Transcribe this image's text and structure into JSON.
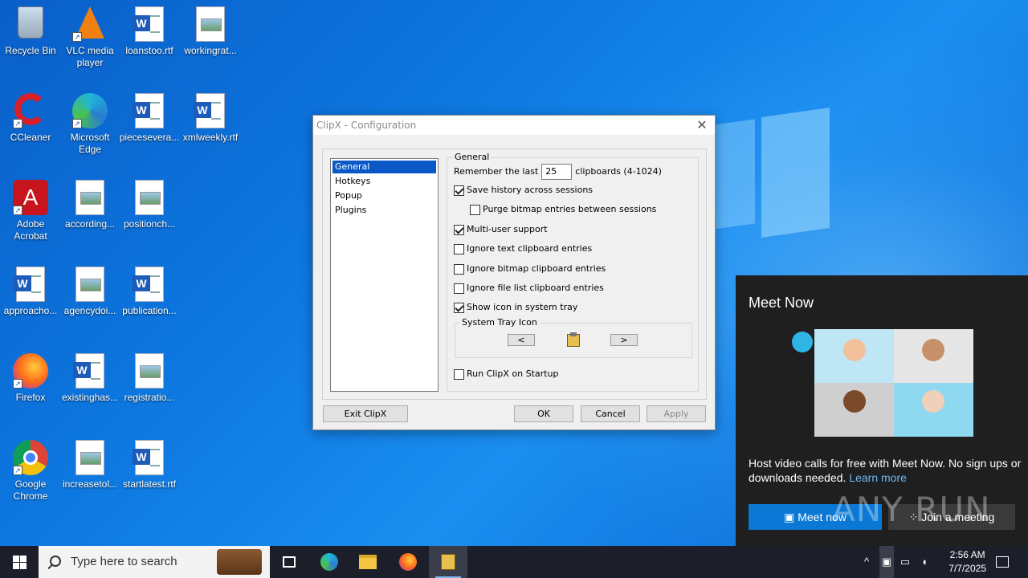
{
  "desktop": {
    "icons": [
      {
        "label": "Recycle Bin",
        "icon": "recycle-bin-icon"
      },
      {
        "label": "VLC media player",
        "icon": "vlc-icon"
      },
      {
        "label": "loanstoo.rtf",
        "icon": "word-doc-icon"
      },
      {
        "label": "workingrat...",
        "icon": "image-file-icon"
      },
      {
        "label": "CCleaner",
        "icon": "ccleaner-icon"
      },
      {
        "label": "Microsoft Edge",
        "icon": "edge-icon"
      },
      {
        "label": "piecesevera...",
        "icon": "word-doc-icon"
      },
      {
        "label": "xmlweekly.rtf",
        "icon": "word-doc-icon"
      },
      {
        "label": "Adobe Acrobat",
        "icon": "acrobat-icon"
      },
      {
        "label": "according...",
        "icon": "image-file-icon"
      },
      {
        "label": "positionch...",
        "icon": "image-file-icon"
      },
      {
        "label": "approacho...",
        "icon": "word-doc-icon"
      },
      {
        "label": "agencydoi...",
        "icon": "image-file-icon"
      },
      {
        "label": "publication...",
        "icon": "word-doc-icon"
      },
      {
        "label": "Firefox",
        "icon": "firefox-icon"
      },
      {
        "label": "existinghas...",
        "icon": "word-doc-icon"
      },
      {
        "label": "registratio...",
        "icon": "image-file-icon"
      },
      {
        "label": "Google Chrome",
        "icon": "chrome-icon"
      },
      {
        "label": "increasetol...",
        "icon": "image-file-icon"
      },
      {
        "label": "startlatest.rtf",
        "icon": "word-doc-icon"
      }
    ]
  },
  "dialog": {
    "title": "ClipX - Configuration",
    "tree": [
      "General",
      "Hotkeys",
      "Popup",
      "Plugins"
    ],
    "group_title": "General",
    "remember_prefix": "Remember the last",
    "remember_value": "25",
    "remember_suffix": "clipboards (4-1024)",
    "options": [
      {
        "label": "Save history across sessions",
        "checked": true
      },
      {
        "label": "Purge bitmap entries between sessions",
        "checked": false
      },
      {
        "label": "Multi-user support",
        "checked": true
      },
      {
        "label": "Ignore text clipboard entries",
        "checked": false
      },
      {
        "label": "Ignore bitmap clipboard entries",
        "checked": false
      },
      {
        "label": "Ignore file list clipboard entries",
        "checked": false
      },
      {
        "label": "Show icon in system tray",
        "checked": true
      },
      {
        "label": "Run ClipX on Startup",
        "checked": false
      }
    ],
    "tray_group_title": "System Tray Icon",
    "prev_label": "<",
    "next_label": ">",
    "buttons": {
      "exit": "Exit ClipX",
      "ok": "OK",
      "cancel": "Cancel",
      "apply": "Apply"
    }
  },
  "meet_now": {
    "title": "Meet Now",
    "description": "Host video calls for free with Meet Now. No sign ups or downloads needed.",
    "learn_more": "Learn more",
    "meet_now_button": "Meet now",
    "join_button": "Join a meeting"
  },
  "watermark": "ANY RUN",
  "taskbar": {
    "search_placeholder": "Type here to search",
    "time": "2:56 AM",
    "date": "7/7/2025"
  },
  "colors": {
    "accent": "#0a78d4",
    "selection": "#0a58c8",
    "taskbar": "#1c1f2a"
  }
}
